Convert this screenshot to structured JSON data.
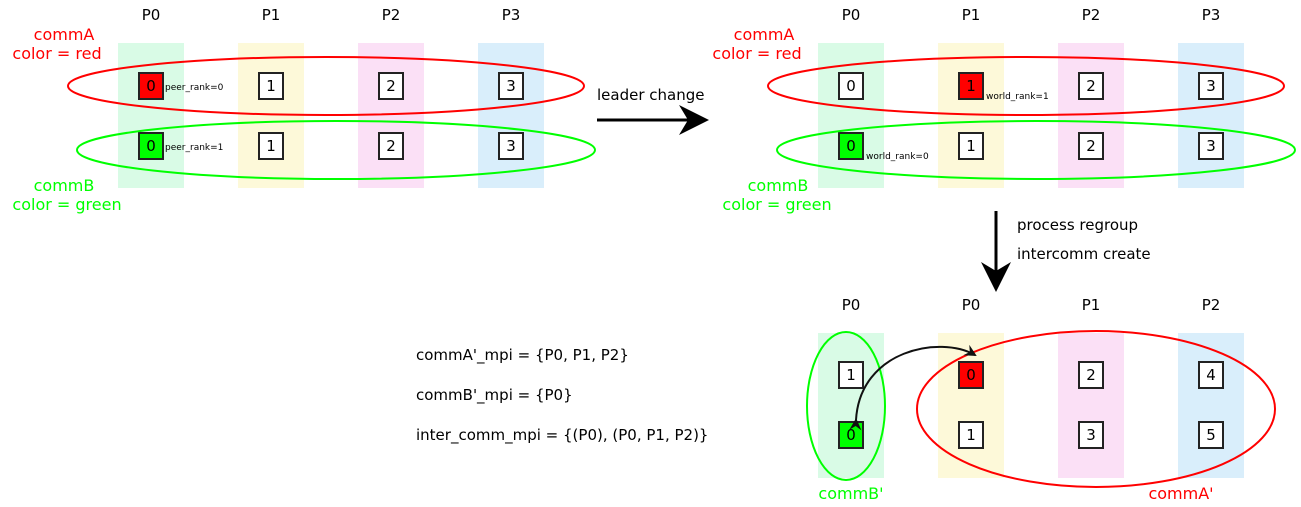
{
  "colors": {
    "red": "#ff0000",
    "green": "#00ff00",
    "band_p0": "#d9fbe6",
    "band_p1": "#fdf9d9",
    "band_p2": "#fbe0f6",
    "band_p3": "#d9eefb"
  },
  "panel1": {
    "headers": [
      "P0",
      "P1",
      "P2",
      "P3"
    ],
    "row_a": [
      "0",
      "1",
      "2",
      "3"
    ],
    "row_b": [
      "0",
      "1",
      "2",
      "3"
    ],
    "note_a": "peer_rank=0",
    "note_b": "peer_rank=1",
    "commA_name": "commA",
    "commA_color": "color = red",
    "commB_name": "commB",
    "commB_color": "color = green"
  },
  "arrow1_label": "leader change",
  "panel2": {
    "headers": [
      "P0",
      "P1",
      "P2",
      "P3"
    ],
    "row_a": [
      "0",
      "1",
      "2",
      "3"
    ],
    "row_b": [
      "0",
      "1",
      "2",
      "3"
    ],
    "note_a": "world_rank=1",
    "note_b": "world_rank=0",
    "commA_name": "commA",
    "commA_color": "color = red",
    "commB_name": "commB",
    "commB_color": "color = green"
  },
  "arrow2_labels": [
    "process regroup",
    "intercomm create"
  ],
  "panel3": {
    "headers": [
      "P0",
      "P0",
      "P1",
      "P2"
    ],
    "row_a": [
      "1",
      "0",
      "2",
      "4"
    ],
    "row_b": [
      "0",
      "1",
      "3",
      "5"
    ],
    "commB_label": "commB'",
    "commA_label": "commA'"
  },
  "equations": [
    "commA'_mpi = {P0, P1, P2}",
    "commB'_mpi = {P0}",
    "inter_comm_mpi = {(P0), (P0, P1, P2)}"
  ]
}
